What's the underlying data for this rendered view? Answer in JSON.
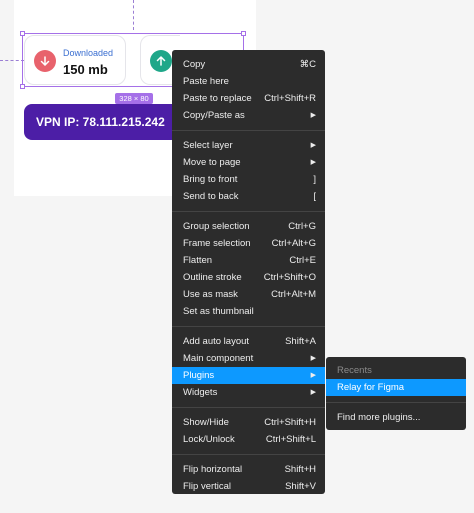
{
  "canvas": {
    "card_downloaded": {
      "label": "Downloaded",
      "value": "150 mb"
    },
    "selection_size": "328 × 80",
    "vpn": {
      "text": "VPN IP: 78.111.215.242"
    },
    "colors": {
      "selection": "#a570e8",
      "vpn_bg": "#4c1ea6",
      "download_icon": "#e8626c",
      "upload_icon": "#1fa789"
    }
  },
  "menu": {
    "groups": [
      [
        {
          "label": "Copy",
          "shortcut": "⌘C"
        },
        {
          "label": "Paste here",
          "shortcut": ""
        },
        {
          "label": "Paste to replace",
          "shortcut": "Ctrl+Shift+R"
        },
        {
          "label": "Copy/Paste as",
          "shortcut": "▶"
        }
      ],
      [
        {
          "label": "Select layer",
          "shortcut": "▶"
        },
        {
          "label": "Move to page",
          "shortcut": "▶"
        },
        {
          "label": "Bring to front",
          "shortcut": "]"
        },
        {
          "label": "Send to back",
          "shortcut": "["
        }
      ],
      [
        {
          "label": "Group selection",
          "shortcut": "Ctrl+G"
        },
        {
          "label": "Frame selection",
          "shortcut": "Ctrl+Alt+G"
        },
        {
          "label": "Flatten",
          "shortcut": "Ctrl+E"
        },
        {
          "label": "Outline stroke",
          "shortcut": "Ctrl+Shift+O"
        },
        {
          "label": "Use as mask",
          "shortcut": "Ctrl+Alt+M"
        },
        {
          "label": "Set as thumbnail",
          "shortcut": ""
        }
      ],
      [
        {
          "label": "Add auto layout",
          "shortcut": "Shift+A"
        },
        {
          "label": "Main component",
          "shortcut": "▶"
        },
        {
          "label": "Plugins",
          "shortcut": "▶"
        },
        {
          "label": "Widgets",
          "shortcut": "▶"
        }
      ],
      [
        {
          "label": "Show/Hide",
          "shortcut": "Ctrl+Shift+H"
        },
        {
          "label": "Lock/Unlock",
          "shortcut": "Ctrl+Shift+L"
        }
      ],
      [
        {
          "label": "Flip horizontal",
          "shortcut": "Shift+H"
        },
        {
          "label": "Flip vertical",
          "shortcut": "Shift+V"
        }
      ]
    ],
    "highlight_color": "#0d99ff"
  },
  "submenu": {
    "heading": "Recents",
    "recent_item": "Relay for Figma",
    "find_more": "Find more plugins..."
  }
}
